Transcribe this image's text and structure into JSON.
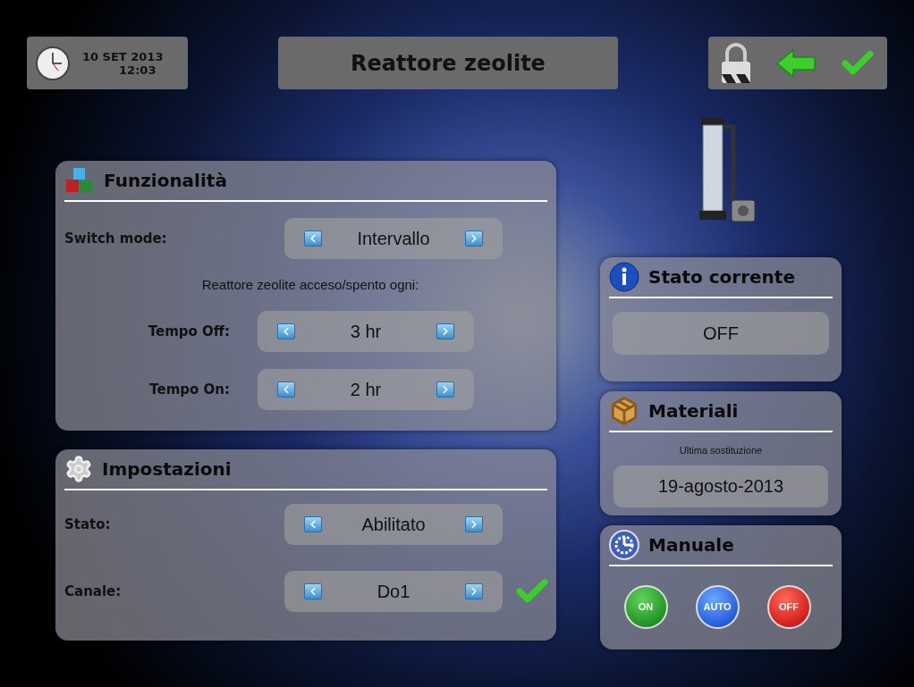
{
  "header": {
    "date": "10 SET 2013",
    "time": "12:03",
    "title": "Reattore zeolite"
  },
  "funzionalita": {
    "title": "Funzionalità",
    "rows": [
      {
        "kind": "selector",
        "label": "Switch mode:",
        "value": "Intervallo"
      },
      {
        "kind": "note",
        "label": "Reattore zeolite acceso/spento ogni:"
      },
      {
        "kind": "timer",
        "label": "Tempo Off:",
        "value": "3 hr"
      },
      {
        "kind": "timer",
        "label": "Tempo On:",
        "value": "2 hr"
      }
    ]
  },
  "impostazioni": {
    "title": "Impostazioni",
    "rows": [
      {
        "label": "Stato:",
        "value": "Abilitato",
        "confirmed": false
      },
      {
        "label": "Canale:",
        "value": "Do1",
        "confirmed": true
      }
    ]
  },
  "stato_corrente": {
    "title": "Stato corrente",
    "value": "OFF"
  },
  "materiali": {
    "title": "Materiali",
    "caption": "Ultima sostituzione",
    "value": "19-agosto-2013"
  },
  "manuale": {
    "title": "Manuale",
    "buttons": [
      {
        "label": "ON",
        "kind": "on"
      },
      {
        "label": "AUTO",
        "kind": "auto"
      },
      {
        "label": "OFF",
        "kind": "off"
      }
    ]
  }
}
